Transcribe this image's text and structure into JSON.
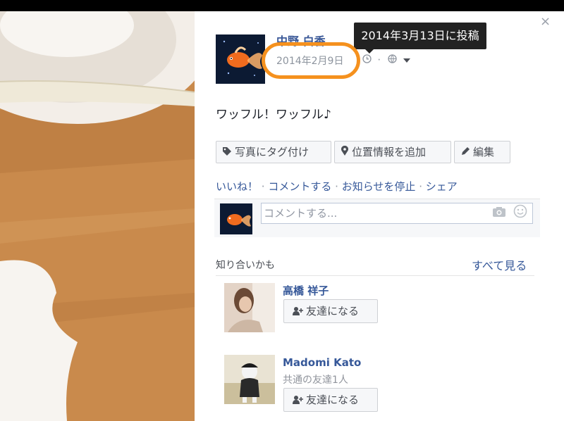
{
  "post": {
    "author": "中野 白香",
    "date": "2014年2月9日",
    "tooltip": "2014年3月13日に投稿",
    "text": "ワッフル！ワッフル♪"
  },
  "buttons": {
    "tag_photo": "写真にタグ付け",
    "add_location": "位置情報を追加",
    "edit": "編集"
  },
  "actions": {
    "like": "いいね！",
    "comment": "コメントする",
    "stop_notifications": "お知らせを停止",
    "share": "シェア",
    "separator": "·"
  },
  "comment": {
    "placeholder": "コメントする..."
  },
  "suggestions": {
    "title": "知り合いかも",
    "see_all": "すべて見る",
    "people": [
      {
        "name": "高橋 祥子",
        "mutual": "",
        "button": "友達になる"
      },
      {
        "name": "Madomi Kato",
        "mutual": "共通の友達1人",
        "button": "友達になる"
      }
    ]
  },
  "icons": {
    "close": "close-icon",
    "clock": "clock-icon",
    "globe": "globe-icon",
    "tag": "tag-icon",
    "pin": "location-pin-icon",
    "pencil": "pencil-icon",
    "camera": "camera-icon",
    "smiley": "smiley-icon",
    "add_friend": "add-friend-icon"
  },
  "colors": {
    "link": "#365899",
    "highlight": "#f5911e",
    "tooltip_bg": "#222222"
  }
}
